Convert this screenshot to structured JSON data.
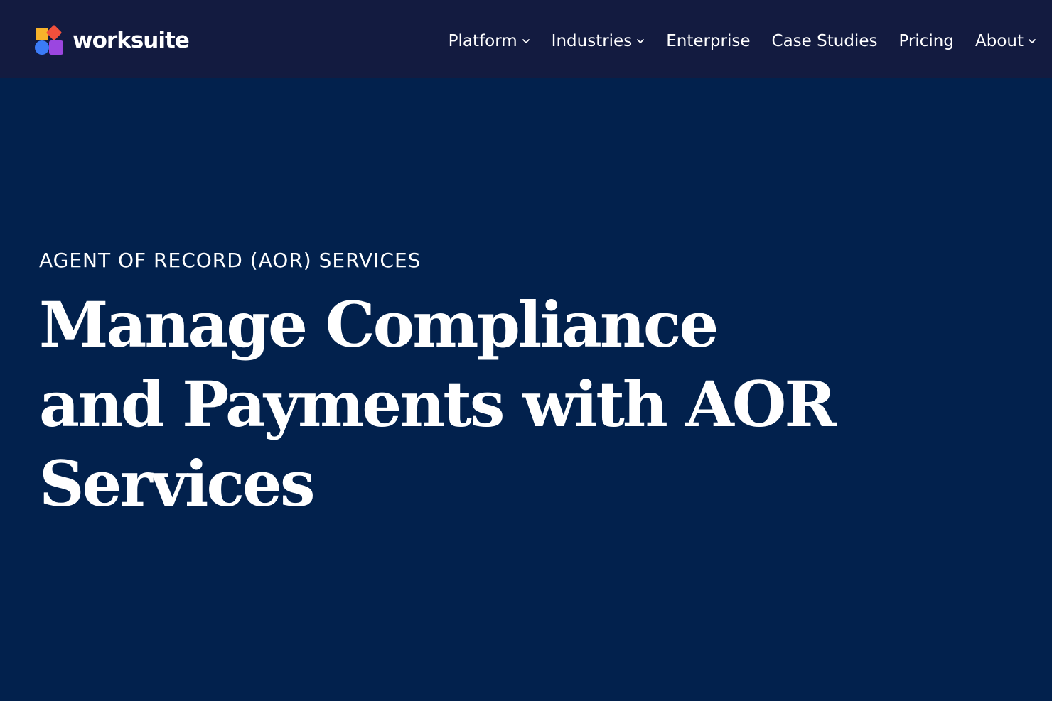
{
  "colors": {
    "nav_bg": "#131b40",
    "hero_bg": "#02214d",
    "text": "#ffffff",
    "logo_yellow": "#f7b32b",
    "logo_red": "#f0503c",
    "logo_blue": "#3b7bf6",
    "logo_purple": "#9b46e0"
  },
  "brand": {
    "name": "worksuite",
    "logo_icon": "worksuite-logo-icon"
  },
  "nav": {
    "items": [
      {
        "label": "Platform",
        "has_dropdown": true,
        "icon": "chevron-down-icon"
      },
      {
        "label": "Industries",
        "has_dropdown": true,
        "icon": "chevron-down-icon"
      },
      {
        "label": "Enterprise",
        "has_dropdown": false
      },
      {
        "label": "Case Studies",
        "has_dropdown": false
      },
      {
        "label": "Pricing",
        "has_dropdown": false
      },
      {
        "label": "About",
        "has_dropdown": true,
        "icon": "chevron-down-icon"
      }
    ]
  },
  "hero": {
    "eyebrow": "AGENT OF RECORD (AOR) SERVICES",
    "headline": "Manage Compliance and Payments with AOR Services"
  }
}
